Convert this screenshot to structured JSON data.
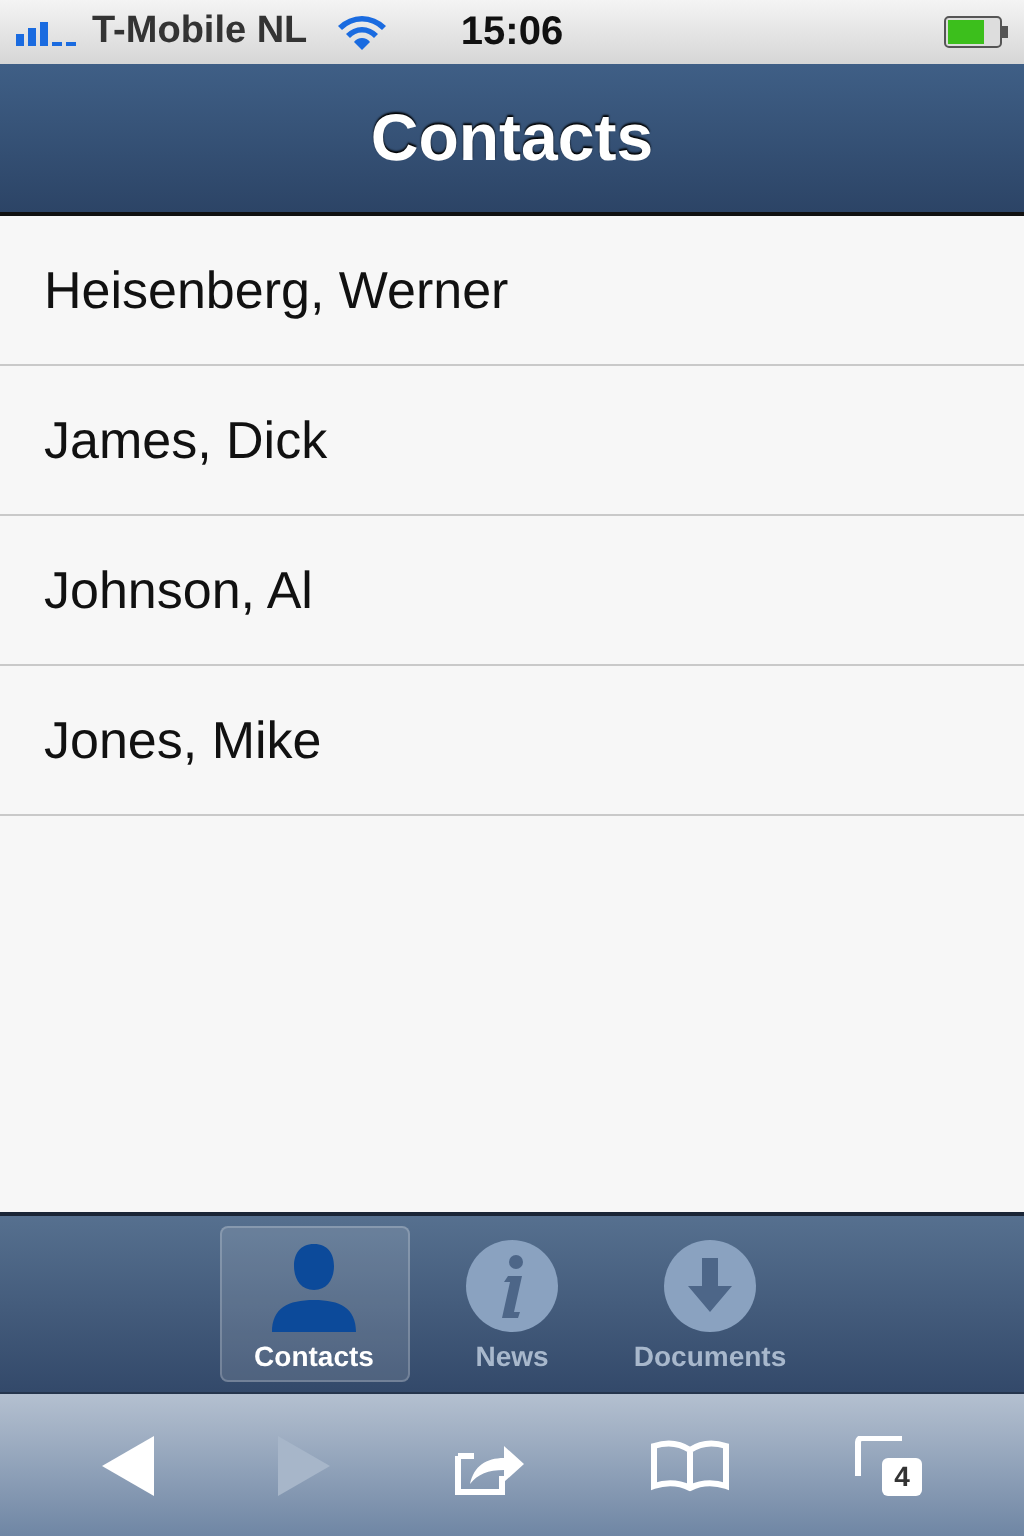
{
  "status_bar": {
    "carrier": "T-Mobile NL",
    "time": "15:06"
  },
  "nav_bar": {
    "title": "Contacts"
  },
  "contacts": [
    {
      "name": "Heisenberg, Werner"
    },
    {
      "name": "James, Dick"
    },
    {
      "name": "Johnson, Al"
    },
    {
      "name": "Jones, Mike"
    }
  ],
  "tabs": [
    {
      "kind": "person",
      "label": "Contacts",
      "selected": true
    },
    {
      "kind": "info",
      "label": "News",
      "selected": false
    },
    {
      "kind": "download",
      "label": "Documents",
      "selected": false
    }
  ],
  "toolbar": {
    "back": {
      "disabled": false
    },
    "forward": {
      "disabled": true
    },
    "tab_count": "4"
  }
}
